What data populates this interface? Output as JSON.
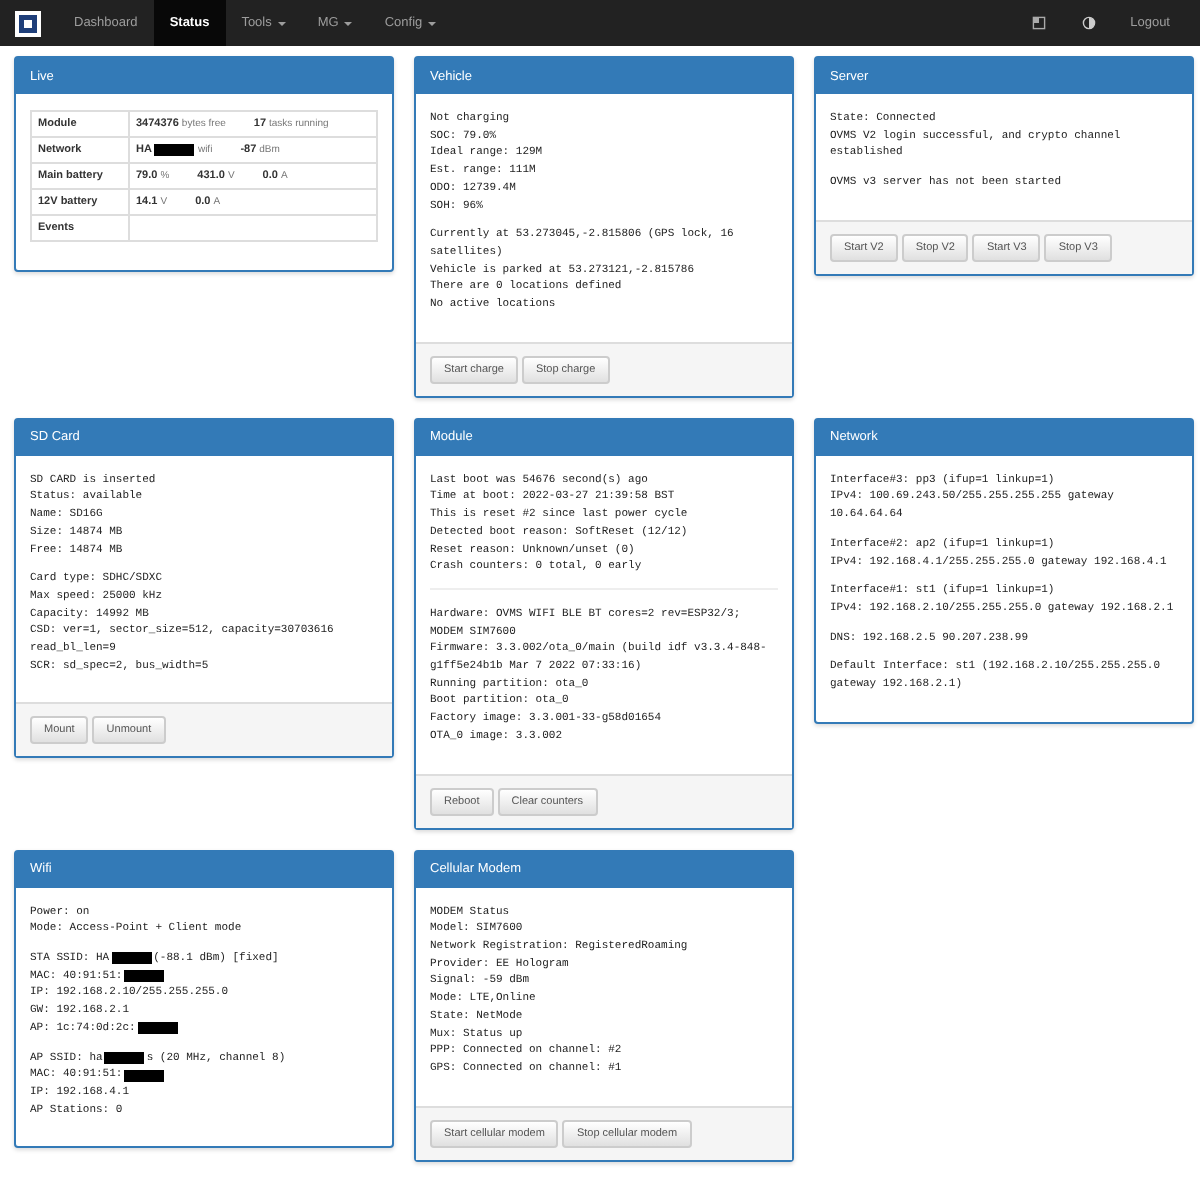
{
  "navbar": {
    "items": [
      {
        "label": "Dashboard",
        "selected": false,
        "dropdown": false
      },
      {
        "label": "Status",
        "selected": true,
        "dropdown": false
      },
      {
        "label": "Tools",
        "selected": false,
        "dropdown": true
      },
      {
        "label": "MG",
        "selected": false,
        "dropdown": true
      },
      {
        "label": "Config",
        "selected": false,
        "dropdown": true
      }
    ],
    "logout": "Logout"
  },
  "panels": [
    {
      "title": "Live",
      "kind": "table",
      "rows": [
        {
          "label": "Module",
          "values": [
            {
              "value": "3474376",
              "unit": "bytes free"
            },
            {
              "value": "17",
              "unit": "tasks running"
            }
          ]
        },
        {
          "label": "Network",
          "values": [
            {
              "value": "HA",
              "unit": "wifi",
              "redacted": true
            },
            {
              "value": "-87",
              "unit": "dBm"
            }
          ]
        },
        {
          "label": "Main battery",
          "values": [
            {
              "value": "79.0",
              "unit": "%"
            },
            {
              "value": "431.0",
              "unit": "V"
            },
            {
              "value": "0.0",
              "unit": "A"
            }
          ]
        },
        {
          "label": "12V battery",
          "values": [
            {
              "value": "14.1",
              "unit": "V"
            },
            {
              "value": "0.0",
              "unit": "A"
            }
          ]
        },
        {
          "label": "Events",
          "values": []
        }
      ]
    },
    {
      "title": "Vehicle",
      "kind": "text",
      "sections": [
        {
          "rule": false,
          "lines": [
            "Not charging",
            "SOC: 79.0%",
            "Ideal range: 129M",
            "Est. range: 111M",
            "ODO: 12739.4M",
            "SOH: 96%"
          ]
        },
        {
          "rule": false,
          "lines": [
            "Currently at 53.273045,-2.815806 (GPS lock, 16 satellites)",
            "Vehicle is parked at 53.273121,-2.815786",
            "There are 0 locations defined",
            "No active locations"
          ]
        }
      ],
      "buttons": [
        "Start charge",
        "Stop charge"
      ]
    },
    {
      "title": "Server",
      "kind": "text",
      "sections": [
        {
          "rule": false,
          "lines": [
            "State: Connected",
            "OVMS V2 login successful, and crypto channel established"
          ]
        },
        {
          "rule": false,
          "lines": [
            "OVMS v3 server has not been started"
          ]
        }
      ],
      "buttons": [
        "Start V2",
        "Stop V2",
        "Start V3",
        "Stop V3"
      ]
    },
    {
      "title": "SD Card",
      "kind": "text",
      "sections": [
        {
          "rule": false,
          "lines": [
            "SD CARD is inserted",
            "Status: available",
            "Name: SD16G",
            "Size: 14874 MB",
            "Free: 14874 MB"
          ]
        },
        {
          "rule": false,
          "lines": [
            "Card type: SDHC/SDXC",
            "Max speed: 25000 kHz",
            "Capacity: 14992 MB",
            "CSD: ver=1, sector_size=512, capacity=30703616 read_bl_len=9",
            "SCR: sd_spec=2, bus_width=5"
          ]
        }
      ],
      "buttons": [
        "Mount",
        "Unmount"
      ]
    },
    {
      "title": "Module",
      "kind": "text",
      "sections": [
        {
          "rule": false,
          "lines": [
            "Last boot was 54676 second(s) ago",
            "Time at boot: 2022-03-27 21:39:58 BST",
            "This is reset #2 since last power cycle",
            "Detected boot reason: SoftReset (12/12)",
            "Reset reason: Unknown/unset (0)",
            "Crash counters: 0 total, 0 early"
          ]
        },
        {
          "rule": true,
          "lines": [
            "Hardware: OVMS WIFI BLE BT cores=2 rev=ESP32/3; MODEM SIM7600",
            "Firmware: 3.3.002/ota_0/main (build idf v3.3.4-848-g1ff5e24b1b Mar 7 2022 07:33:16)",
            "Running partition: ota_0",
            "Boot partition: ota_0",
            "Factory image: 3.3.001-33-g58d01654",
            "OTA_0 image: 3.3.002"
          ]
        }
      ],
      "buttons": [
        "Reboot",
        "Clear counters"
      ]
    },
    {
      "title": "Network",
      "kind": "text",
      "sections": [
        {
          "rule": false,
          "lines": [
            "Interface#3: pp3 (ifup=1 linkup=1)",
            "IPv4: 100.69.243.50/255.255.255.255 gateway 10.64.64.64"
          ]
        },
        {
          "rule": false,
          "lines": [
            "Interface#2: ap2 (ifup=1 linkup=1)",
            "IPv4: 192.168.4.1/255.255.255.0 gateway 192.168.4.1"
          ]
        },
        {
          "rule": false,
          "lines": [
            "Interface#1: st1 (ifup=1 linkup=1)",
            "IPv4: 192.168.2.10/255.255.255.0 gateway 192.168.2.1"
          ]
        },
        {
          "rule": false,
          "lines": [
            "DNS: 192.168.2.5 90.207.238.99"
          ]
        },
        {
          "rule": false,
          "lines": [
            "Default Interface: st1 (192.168.2.10/255.255.255.0 gateway 192.168.2.1)"
          ]
        }
      ]
    },
    {
      "title": "Wifi",
      "kind": "text",
      "sections": [
        {
          "rule": false,
          "lines": [
            "Power: on",
            "Mode: Access-Point + Client mode"
          ]
        },
        {
          "rule": false,
          "lines": [
            {
              "before": "STA SSID: HA",
              "after": "(-88.1 dBm) [fixed]"
            },
            {
              "before": "MAC: 40:91:51:"
            },
            "IP: 192.168.2.10/255.255.255.0",
            "GW: 192.168.2.1",
            {
              "before": "AP: 1c:74:0d:2c:"
            }
          ]
        },
        {
          "rule": false,
          "lines": [
            {
              "before": "AP SSID: ha",
              "after": "s (20 MHz, channel 8)"
            },
            {
              "before": "MAC: 40:91:51:"
            },
            "IP: 192.168.4.1",
            "AP Stations: 0"
          ]
        }
      ]
    },
    {
      "title": "Cellular Modem",
      "kind": "text",
      "sections": [
        {
          "rule": false,
          "lines": [
            "MODEM Status",
            "Model: SIM7600",
            "Network Registration: RegisteredRoaming",
            "Provider: EE Hologram",
            "Signal: -59 dBm",
            "Mode: LTE,Online",
            "State: NetMode",
            "Mux: Status up",
            "PPP: Connected on channel: #2",
            "GPS: Connected on channel: #1"
          ]
        }
      ],
      "buttons": [
        "Start cellular modem",
        "Stop cellular modem"
      ]
    }
  ]
}
